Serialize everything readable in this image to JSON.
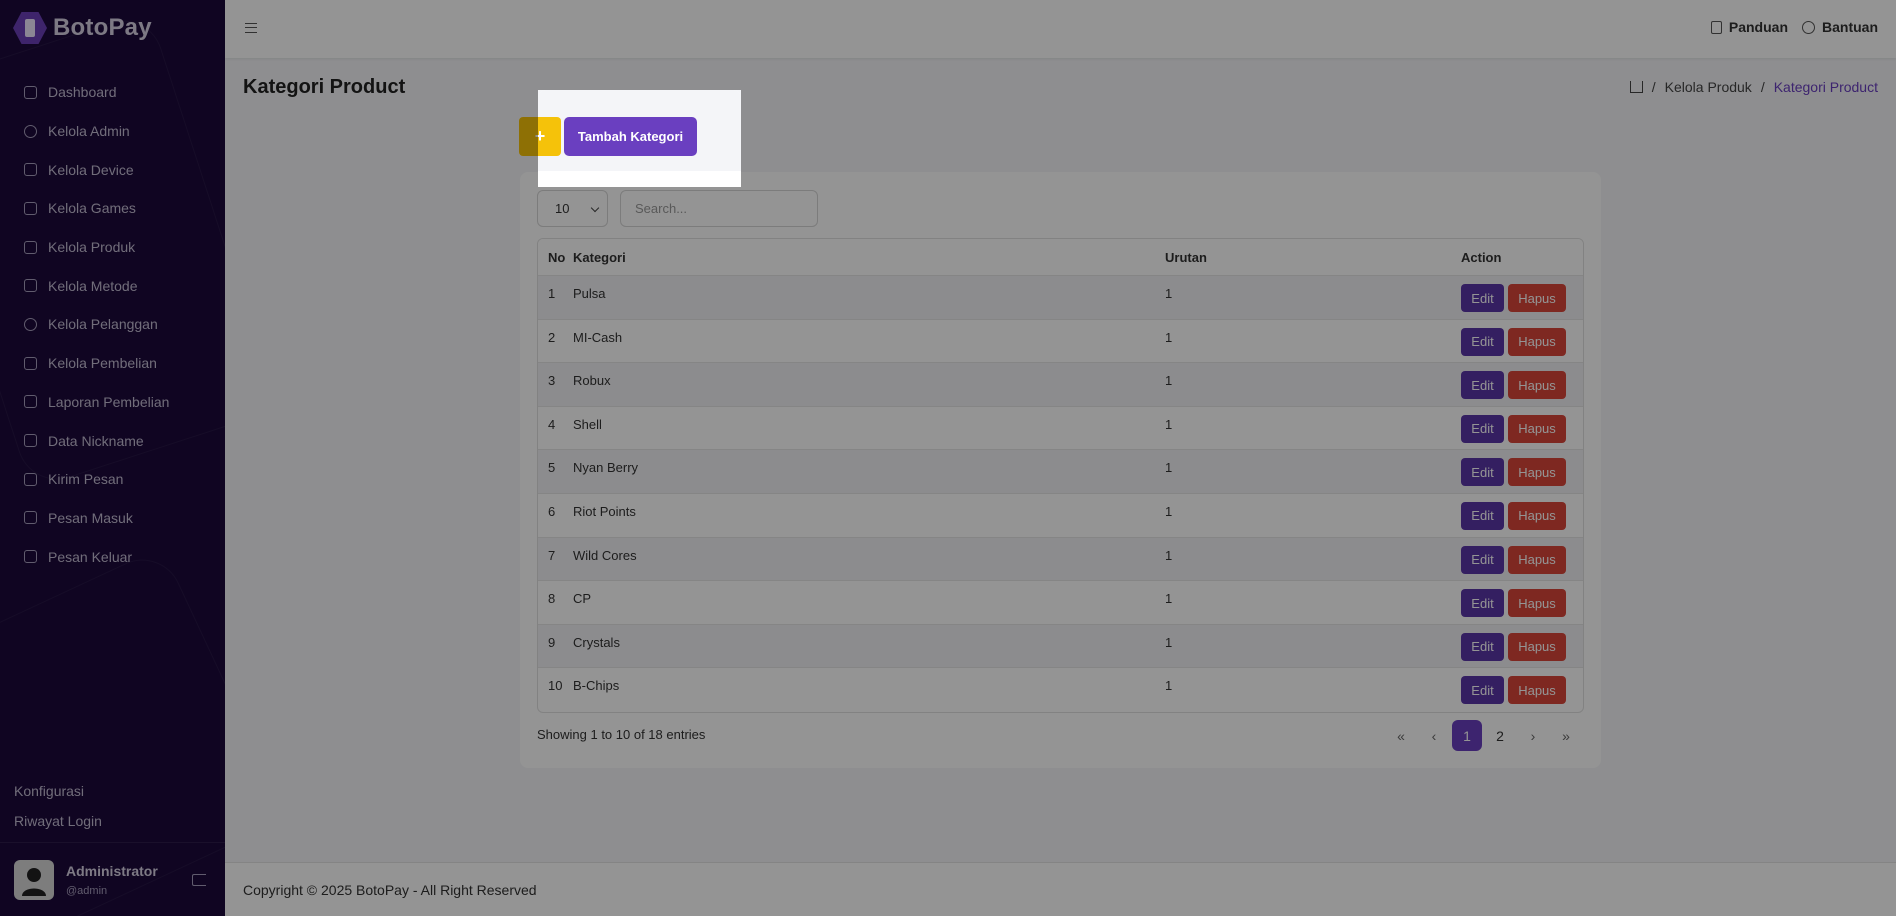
{
  "brand": {
    "name": "BotoPay"
  },
  "sidebar": {
    "items": [
      {
        "label": "Dashboard",
        "icon": "home-icon"
      },
      {
        "label": "Kelola Admin",
        "icon": "user-icon"
      },
      {
        "label": "Kelola Device",
        "icon": "devices-icon"
      },
      {
        "label": "Kelola Games",
        "icon": "gamepad-icon"
      },
      {
        "label": "Kelola Produk",
        "icon": "box-icon"
      },
      {
        "label": "Kelola Metode",
        "icon": "credit-card-icon"
      },
      {
        "label": "Kelola Pelanggan",
        "icon": "users-icon"
      },
      {
        "label": "Kelola Pembelian",
        "icon": "cart-icon"
      },
      {
        "label": "Laporan Pembelian",
        "icon": "report-icon"
      },
      {
        "label": "Data Nickname",
        "icon": "id-card-icon"
      },
      {
        "label": "Kirim Pesan",
        "icon": "send-icon"
      },
      {
        "label": "Pesan Masuk",
        "icon": "inbox-icon"
      },
      {
        "label": "Pesan Keluar",
        "icon": "outbox-icon"
      }
    ],
    "bottom": [
      "Konfigurasi",
      "Riwayat Login"
    ],
    "user": {
      "name": "Administrator",
      "handle": "@admin"
    }
  },
  "header": {
    "links": [
      {
        "label": "Panduan",
        "icon": "book-icon"
      },
      {
        "label": "Bantuan",
        "icon": "help-icon"
      }
    ]
  },
  "page": {
    "title": "Kategori Product",
    "breadcrumb": [
      "Kelola Produk",
      "Kategori Product"
    ],
    "add_plus": "+",
    "add_button": "Tambah Kategori"
  },
  "table_controls": {
    "page_length": "10",
    "search_placeholder": "Search..."
  },
  "table": {
    "headers": [
      "No",
      "Kategori",
      "Urutan",
      "Action"
    ],
    "rows": [
      {
        "no": "1",
        "kategori": "Pulsa",
        "urutan": "1"
      },
      {
        "no": "2",
        "kategori": "MI-Cash",
        "urutan": "1"
      },
      {
        "no": "3",
        "kategori": "Robux",
        "urutan": "1"
      },
      {
        "no": "4",
        "kategori": "Shell",
        "urutan": "1"
      },
      {
        "no": "5",
        "kategori": "Nyan Berry",
        "urutan": "1"
      },
      {
        "no": "6",
        "kategori": "Riot Points",
        "urutan": "1"
      },
      {
        "no": "7",
        "kategori": "Wild Cores",
        "urutan": "1"
      },
      {
        "no": "8",
        "kategori": "CP",
        "urutan": "1"
      },
      {
        "no": "9",
        "kategori": "Crystals",
        "urutan": "1"
      },
      {
        "no": "10",
        "kategori": "B-Chips",
        "urutan": "1"
      }
    ],
    "edit_label": "Edit",
    "delete_label": "Hapus"
  },
  "pagination": {
    "info": "Showing 1 to 10 of 18 entries",
    "first": "«",
    "prev": "‹",
    "pages": [
      "1",
      "2"
    ],
    "next": "›",
    "last": "»"
  },
  "footer": {
    "text": "Copyright © 2025 BotoPay - All Right Reserved"
  },
  "colors": {
    "primary": "#6a3fc0",
    "sidebar": "#1c0a3b",
    "danger": "#d9463a",
    "warning": "#f5c20a"
  }
}
